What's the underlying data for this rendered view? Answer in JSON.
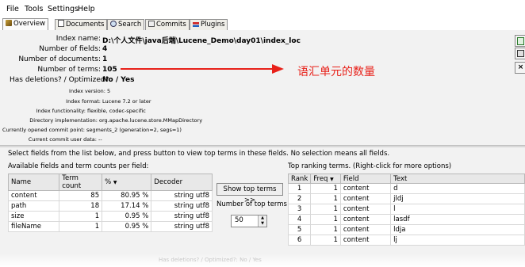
{
  "menu": [
    "File",
    "Tools",
    "Settings",
    "Help"
  ],
  "tabs": [
    "Overview",
    "Documents",
    "Search",
    "Commits",
    "Plugins"
  ],
  "overview": {
    "index_name_label": "Index name:",
    "index_name_value": "D:\\个人文件\\java后端\\Lucene_Demo\\day01\\index_loc",
    "num_fields_label": "Number of fields:",
    "num_fields_value": "4",
    "num_docs_label": "Number of documents:",
    "num_docs_value": "1",
    "num_terms_label": "Number of terms:",
    "num_terms_value": "105",
    "deletions_label": "Has deletions? / Optimized?:",
    "deletions_value": "No / Yes",
    "index_version_label": "Index version:",
    "index_version_value": "5",
    "index_format_label": "Index format:",
    "index_format_value": "Lucene 7.2 or later",
    "index_func_label": "Index functionality:",
    "index_func_value": "flexible, codec-specific",
    "dir_impl_label": "Directory implementation:",
    "dir_impl_value": "org.apache.lucene.store.MMapDirectory",
    "commit_point_label": "Currently opened commit point:",
    "commit_point_value": "segments_2 (generation=2, segs=1)",
    "commit_user_label": "Current commit user data:",
    "commit_user_value": "--"
  },
  "annotation": {
    "text": "语汇单元的数量",
    "color": "#e8211a"
  },
  "fields_section": {
    "instruction": "Select fields from the list below, and press button to view top terms in these fields. No selection means all fields.",
    "available_label": "Available fields and term counts per field:",
    "columns": [
      "Name",
      "Term count",
      "%",
      "Decoder"
    ],
    "rows": [
      {
        "name": "content",
        "count": "85",
        "pct": "80.95 %",
        "decoder": "string utf8"
      },
      {
        "name": "path",
        "count": "18",
        "pct": "17.14 %",
        "decoder": "string utf8"
      },
      {
        "name": "size",
        "count": "1",
        "pct": "0.95 %",
        "decoder": "string utf8"
      },
      {
        "name": "fileName",
        "count": "1",
        "pct": "0.95 %",
        "decoder": "string utf8"
      }
    ],
    "show_top_terms_button": "Show top terms >>",
    "num_top_terms_label": "Number of top terms:",
    "num_top_terms_value": "50"
  },
  "top_terms": {
    "label": "Top ranking terms. (Right-click for more options)",
    "columns": [
      "Rank",
      "Freq",
      "Field",
      "Text"
    ],
    "rows": [
      {
        "rank": "1",
        "freq": "1",
        "field": "content",
        "text": "d"
      },
      {
        "rank": "2",
        "freq": "1",
        "field": "content",
        "text": "jldj"
      },
      {
        "rank": "3",
        "freq": "1",
        "field": "content",
        "text": "l"
      },
      {
        "rank": "4",
        "freq": "1",
        "field": "content",
        "text": "lasdf"
      },
      {
        "rank": "5",
        "freq": "1",
        "field": "content",
        "text": "ldja"
      },
      {
        "rank": "6",
        "freq": "1",
        "field": "content",
        "text": "lj"
      }
    ]
  },
  "ghost_text": "Has deletions? / Optimized?: No / Yes"
}
